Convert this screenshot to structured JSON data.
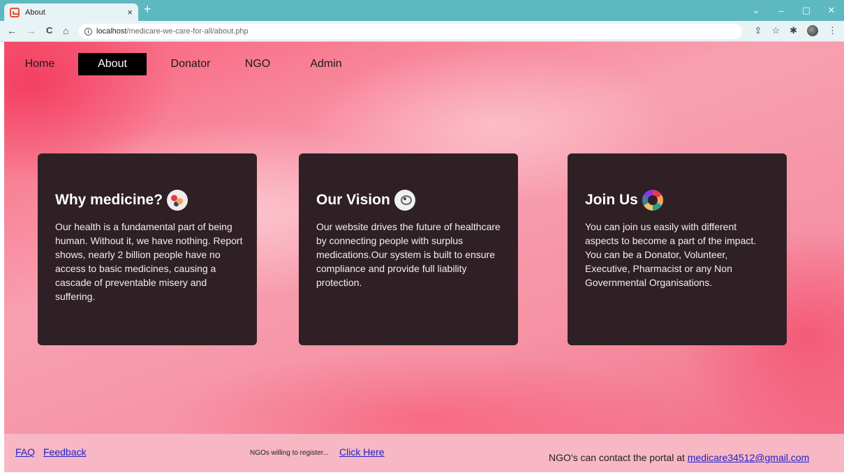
{
  "browser": {
    "tab_title": "About",
    "tab_close": "×",
    "new_tab": "+",
    "url_host": "localhost",
    "url_path": "/medicare-we-care-for-all/about.php",
    "controls": {
      "minimize": "–",
      "maximize": "▢",
      "close": "✕",
      "tab_list": "⌄"
    },
    "nav": {
      "back": "←",
      "forward": "→",
      "reload": "C",
      "home": "⌂"
    }
  },
  "nav": {
    "items": [
      {
        "label": "Home"
      },
      {
        "label": "About",
        "active": true
      },
      {
        "label": "Donator"
      },
      {
        "label": "NGO"
      },
      {
        "label": "Admin"
      }
    ]
  },
  "cards": [
    {
      "title": "Why medicine?",
      "icon": "pills-icon",
      "text": "Our health is a fundamental part of being human. Without it, we have nothing. Report shows, nearly 2 billion people have no access to basic medicines, causing a cascade of preventable misery and suffering."
    },
    {
      "title": "Our Vision",
      "icon": "eye-icon",
      "text": "Our website drives the future of healthcare by connecting people with surplus medications.Our system is built to ensure compliance and provide full liability protection."
    },
    {
      "title": "Join Us",
      "icon": "join-icon",
      "text": "You can join us easily with different aspects to become a part of the impact. You can be a Donator, Volunteer, Executive, Pharmacist or any Non Governmental Organisations."
    }
  ],
  "footer": {
    "faq": "FAQ",
    "feedback": "Feedback",
    "register_prompt": "NGOs willing to register...",
    "register_link": "Click Here",
    "contact_text": "NGO's can contact the portal at ",
    "contact_email": "medicare34512@gmail.com"
  },
  "colors": {
    "card_bg": "#2e2024",
    "footer_bg": "#f7b7c4",
    "link": "#1f1fc8",
    "chrome": "#5db8c0"
  }
}
